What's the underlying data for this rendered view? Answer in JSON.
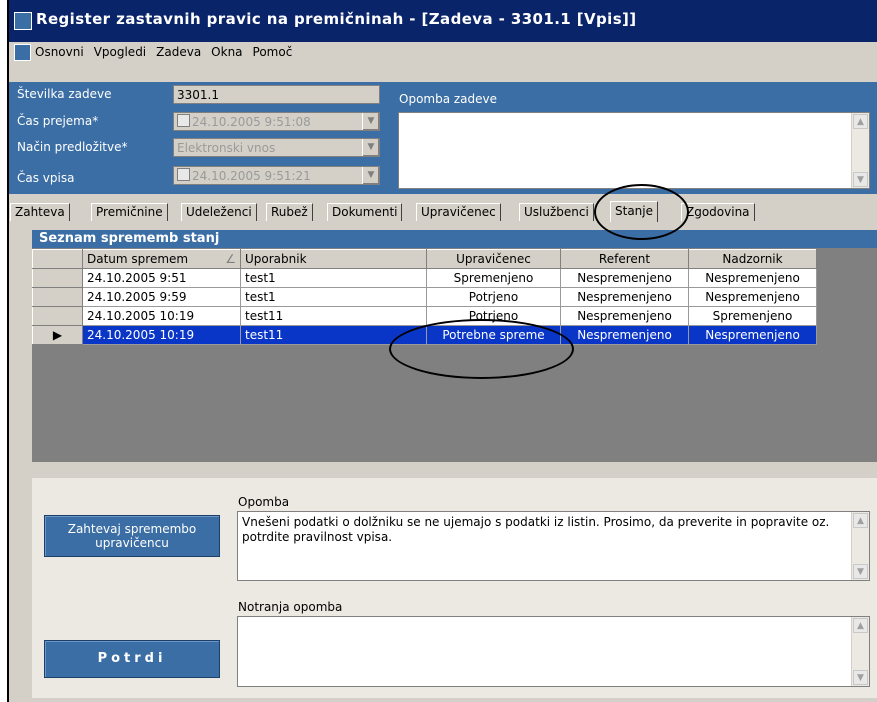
{
  "window": {
    "title": "Register zastavnih pravic na premičninah - [Zadeva - 3301.1 [Vpis]]"
  },
  "menu": {
    "items": [
      "Osnovni",
      "Vpogledi",
      "Zadeva",
      "Okna",
      "Pomoč"
    ]
  },
  "header": {
    "case_number_label": "Številka zadeve",
    "case_number_value": "3301.1",
    "received_label": "Čas prejema*",
    "received_value": "24.10.2005  9:51:08",
    "submission_label": "Način predložitve*",
    "submission_value": "Elektronski vnos",
    "entry_time_label": "Čas vpisa",
    "entry_time_value": "24.10.2005  9:51:21",
    "case_note_label": "Opomba zadeve",
    "case_note_value": ""
  },
  "tabs": [
    "Zahteva",
    "Premičnine",
    "Udeleženci",
    "Rubež",
    "Dokumenti",
    "Upravičenec",
    "Uslužbenci",
    "Stanje",
    "Zgodovina"
  ],
  "active_tab": "Stanje",
  "status_list": {
    "title": "Seznam sprememb stanj",
    "columns": [
      "Datum spremem",
      "Uporabnik",
      "Upravičenec",
      "Referent",
      "Nadzornik"
    ],
    "sort_indicator": "∠",
    "rows": [
      {
        "date": "24.10.2005 9:51",
        "user": "test1",
        "beneficiary": "Spremenjeno",
        "referent": "Nespremenjeno",
        "supervisor": "Nespremenjeno"
      },
      {
        "date": "24.10.2005 9:59",
        "user": "test1",
        "beneficiary": "Potrjeno",
        "referent": "Nespremenjeno",
        "supervisor": "Nespremenjeno"
      },
      {
        "date": "24.10.2005 10:19",
        "user": "test11",
        "beneficiary": "Potrjeno",
        "referent": "Nespremenjeno",
        "supervisor": "Spremenjeno"
      },
      {
        "date": "24.10.2005 10:19",
        "user": "test11",
        "beneficiary": "Potrebne spreme",
        "referent": "Nespremenjeno",
        "supervisor": "Nespremenjeno"
      }
    ],
    "selected_row_marker": "▶"
  },
  "bottom": {
    "request_button": "Zahtevaj spremembo upravičencu",
    "note_label": "Opomba",
    "note_value": "Vnešeni podatki o dolžniku se ne ujemajo s podatki iz listin. Prosimo, da preverite in popravite oz. potrdite pravilnost vpisa.",
    "internal_note_label": "Notranja opomba",
    "internal_note_value": "",
    "confirm_button": "Potrdi"
  },
  "colors": {
    "title_bar": "#0a246a",
    "panel_blue": "#3b6ea5",
    "selection": "#0a36c8"
  }
}
